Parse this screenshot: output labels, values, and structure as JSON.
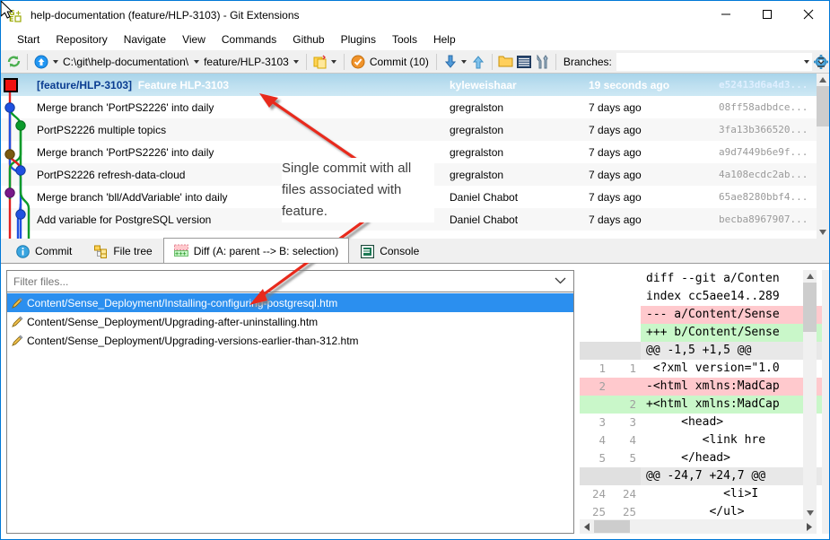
{
  "window": {
    "title": "help-documentation (feature/HLP-3103) - Git Extensions",
    "icon": "git-extensions-icon",
    "minimize_label": "Minimize",
    "maximize_label": "Maximize",
    "close_label": "Close"
  },
  "menubar": {
    "items": [
      {
        "label": "Start"
      },
      {
        "label": "Repository"
      },
      {
        "label": "Navigate"
      },
      {
        "label": "View"
      },
      {
        "label": "Commands"
      },
      {
        "label": "Github"
      },
      {
        "label": "Plugins"
      },
      {
        "label": "Tools"
      },
      {
        "label": "Help"
      }
    ]
  },
  "toolbar": {
    "refresh_icon": "refresh-icon",
    "pull_icon": "pull-arrow-up-icon",
    "repo_path": "C:\\git\\help-documentation\\",
    "branch": "feature/HLP-3103",
    "stash_icon": "stash-icon",
    "commit_label": "Commit (10)",
    "commit_icon": "commit-check-icon",
    "pull_down_icon": "pull-down-arrow-icon",
    "push_up_icon": "push-up-arrow-icon",
    "browse_icon": "folder-icon",
    "terminal_icon": "terminal-icon",
    "settings_tools_icon": "tools-icon",
    "branches_label": "Branches:",
    "branches_value": "",
    "gear_icon": "gear-icon",
    "overflow_icon": "toolbar-overflow-icon"
  },
  "commit_list": {
    "rows": [
      {
        "branch_tag": "[feature/HLP-3103]",
        "message": "Feature HLP-3103",
        "author": "kyleweishaar",
        "date": "19 seconds ago",
        "hash": "e52413d6a4d3...",
        "selected": true
      },
      {
        "branch_tag": "",
        "message": "Merge branch 'PortPS2226' into daily",
        "author": "gregralston",
        "date": "7 days ago",
        "hash": "08ff58adbdce...",
        "selected": false
      },
      {
        "branch_tag": "",
        "message": "PortPS2226 multiple topics",
        "author": "gregralston",
        "date": "7 days ago",
        "hash": "3fa13b366520...",
        "selected": false
      },
      {
        "branch_tag": "",
        "message": "Merge branch 'PortPS2226' into daily",
        "author": "gregralston",
        "date": "7 days ago",
        "hash": "a9d7449b6e9f...",
        "selected": false
      },
      {
        "branch_tag": "",
        "message": "PortPS2226 refresh-data-cloud",
        "author": "gregralston",
        "date": "7 days ago",
        "hash": "4a108ecdc2ab...",
        "selected": false
      },
      {
        "branch_tag": "",
        "message": "Merge branch 'bll/AddVariable' into daily",
        "author": "Daniel Chabot",
        "date": "7 days ago",
        "hash": "65ae8280bbf4...",
        "selected": false
      },
      {
        "branch_tag": "",
        "message": "Add variable for PostgreSQL version",
        "author": "Daniel Chabot",
        "date": "7 days ago",
        "hash": "becba8967907...",
        "selected": false
      }
    ]
  },
  "tabs": [
    {
      "label": "Commit",
      "icon": "info-icon",
      "active": false
    },
    {
      "label": "File tree",
      "icon": "file-tree-icon",
      "active": false
    },
    {
      "label": "Diff (A: parent --> B: selection)",
      "icon": "diff-icon",
      "active": true
    },
    {
      "label": "Console",
      "icon": "console-icon",
      "active": false
    }
  ],
  "file_panel": {
    "filter_placeholder": "Filter files...",
    "filter_value": "",
    "dropdown_icon": "chevron-down-icon",
    "files": [
      {
        "name": "Content/Sense_Deployment/Installing-configuring-postgresql.htm",
        "icon": "pencil-icon",
        "selected": true
      },
      {
        "name": "Content/Sense_Deployment/Upgrading-after-uninstalling.htm",
        "icon": "pencil-icon",
        "selected": false
      },
      {
        "name": "Content/Sense_Deployment/Upgrading-versions-earlier-than-312.htm",
        "icon": "pencil-icon",
        "selected": false
      }
    ]
  },
  "diff": {
    "lines": [
      {
        "old": "",
        "new": "",
        "text": "diff --git a/Conten",
        "kind": "meta"
      },
      {
        "old": "",
        "new": "",
        "text": "index cc5aee14..289",
        "kind": "meta"
      },
      {
        "old": "",
        "new": "",
        "text": "--- a/Content/Sense",
        "kind": "del"
      },
      {
        "old": "",
        "new": "",
        "text": "+++ b/Content/Sense",
        "kind": "add"
      },
      {
        "old": "",
        "new": "",
        "text": "@@ -1,5 +1,5 @@",
        "kind": "hunk"
      },
      {
        "old": "1",
        "new": "1",
        "text": " <?xml version=\"1.0",
        "kind": "ctx"
      },
      {
        "old": "2",
        "new": "",
        "text": "-<html xmlns:MadCap",
        "kind": "del"
      },
      {
        "old": "",
        "new": "2",
        "text": "+<html xmlns:MadCap",
        "kind": "add"
      },
      {
        "old": "3",
        "new": "3",
        "text": "     <head>",
        "kind": "ctx"
      },
      {
        "old": "4",
        "new": "4",
        "text": "        <link hre",
        "kind": "ctx"
      },
      {
        "old": "5",
        "new": "5",
        "text": "     </head>",
        "kind": "ctx"
      },
      {
        "old": "",
        "new": "",
        "text": "@@ -24,7 +24,7 @@",
        "kind": "hunk"
      },
      {
        "old": "24",
        "new": "24",
        "text": "           <li>I",
        "kind": "ctx"
      },
      {
        "old": "25",
        "new": "25",
        "text": "         </ul>",
        "kind": "ctx"
      }
    ],
    "vscroll_icon_up": "scroll-up-icon",
    "vscroll_icon_down": "scroll-down-icon",
    "hscroll_icon_left": "scroll-left-icon",
    "hscroll_icon_right": "scroll-right-icon"
  },
  "annotation": {
    "text": "Single commit with all files associated with feature.",
    "color": "#e8291c",
    "arrow1": "annotation-arrow-to-commit",
    "arrow2": "annotation-arrow-to-file"
  },
  "colors": {
    "selection_blue": "#2b8fef",
    "header_blue": "#0078d7",
    "diff_add": "#c9f7c9",
    "diff_del": "#ffc9cd",
    "diff_hunk": "#e0e0e0",
    "annotation_red": "#e8291c"
  }
}
